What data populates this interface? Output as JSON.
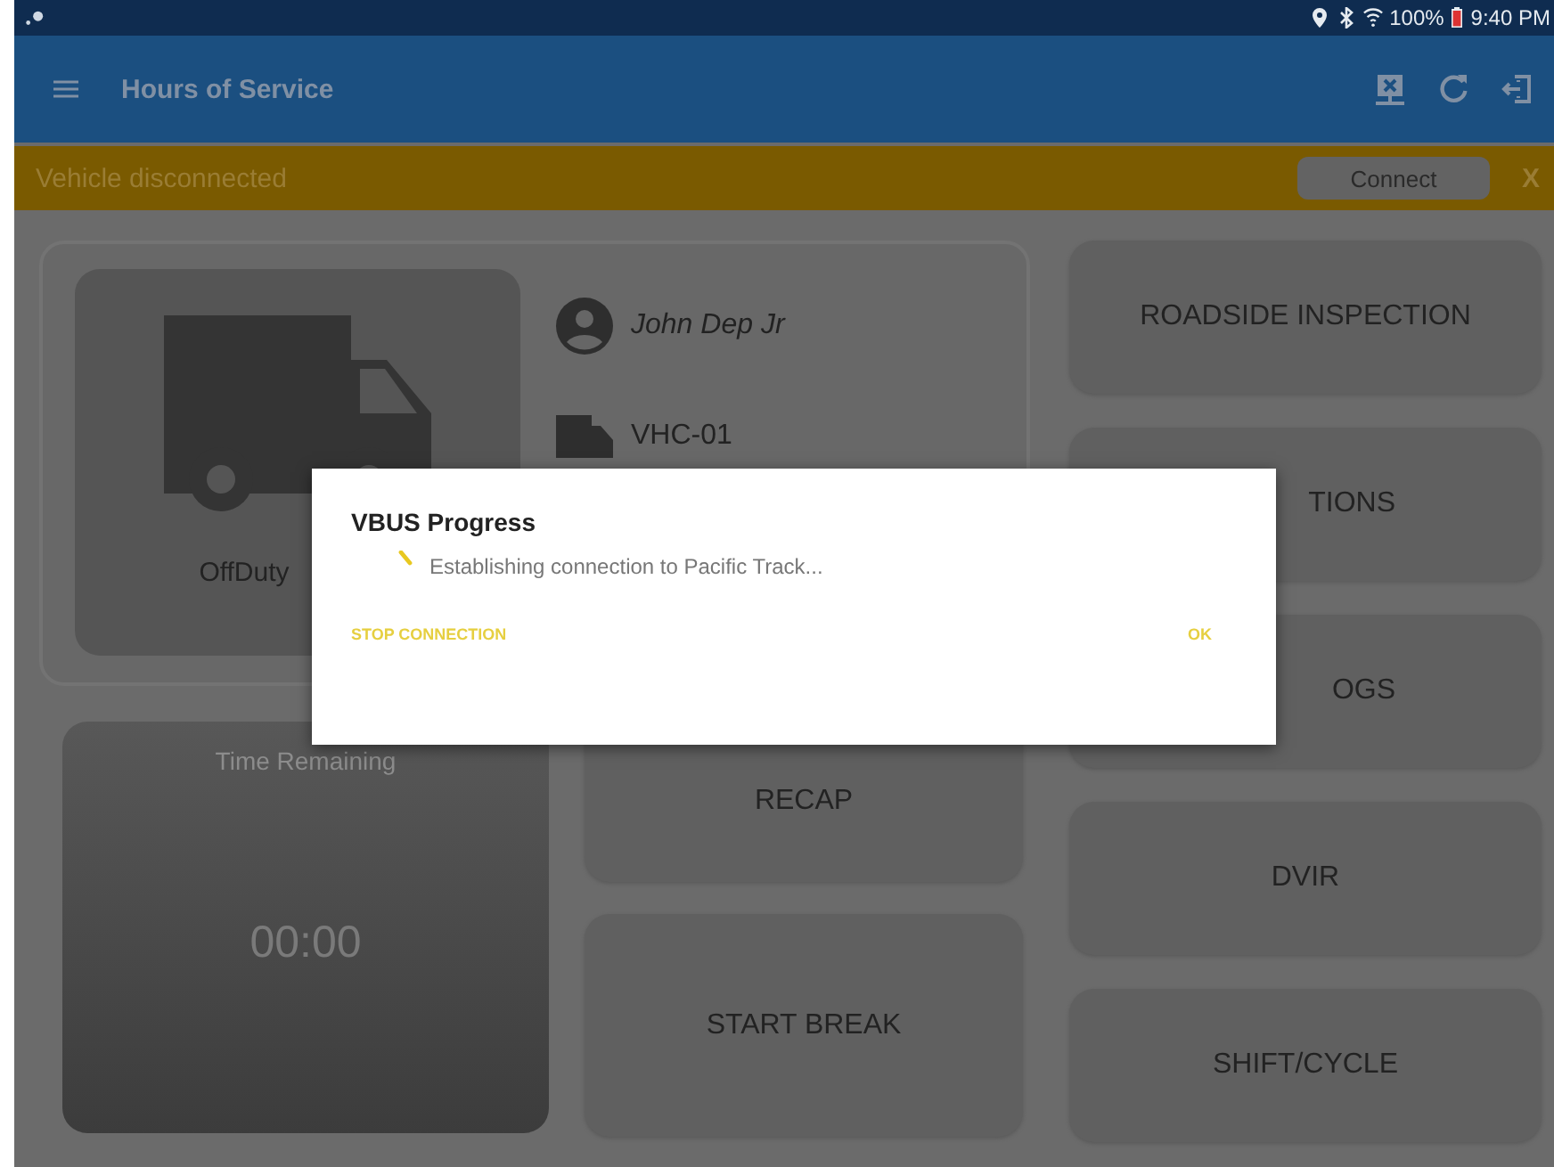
{
  "status_bar": {
    "battery": "100%",
    "time": "9:40 PM"
  },
  "app_bar": {
    "title": "Hours of Service"
  },
  "banner": {
    "message": "Vehicle disconnected",
    "button": "Connect",
    "close": "X"
  },
  "driver_card": {
    "status": "OffDuty",
    "driver": "John Dep Jr",
    "vehicle": "VHC-01"
  },
  "time_card": {
    "label": "Time Remaining",
    "value": "00:00"
  },
  "middle_buttons": [
    "RECAP",
    "START BREAK"
  ],
  "side_buttons": [
    "ROADSIDE INSPECTION",
    "TIONS",
    "OGS",
    "DVIR",
    "SHIFT/CYCLE"
  ],
  "dialog": {
    "title": "VBUS Progress",
    "message": "Establishing connection to Pacific Track...",
    "buttons": [
      "STOP CONNECTION",
      "OK"
    ]
  }
}
